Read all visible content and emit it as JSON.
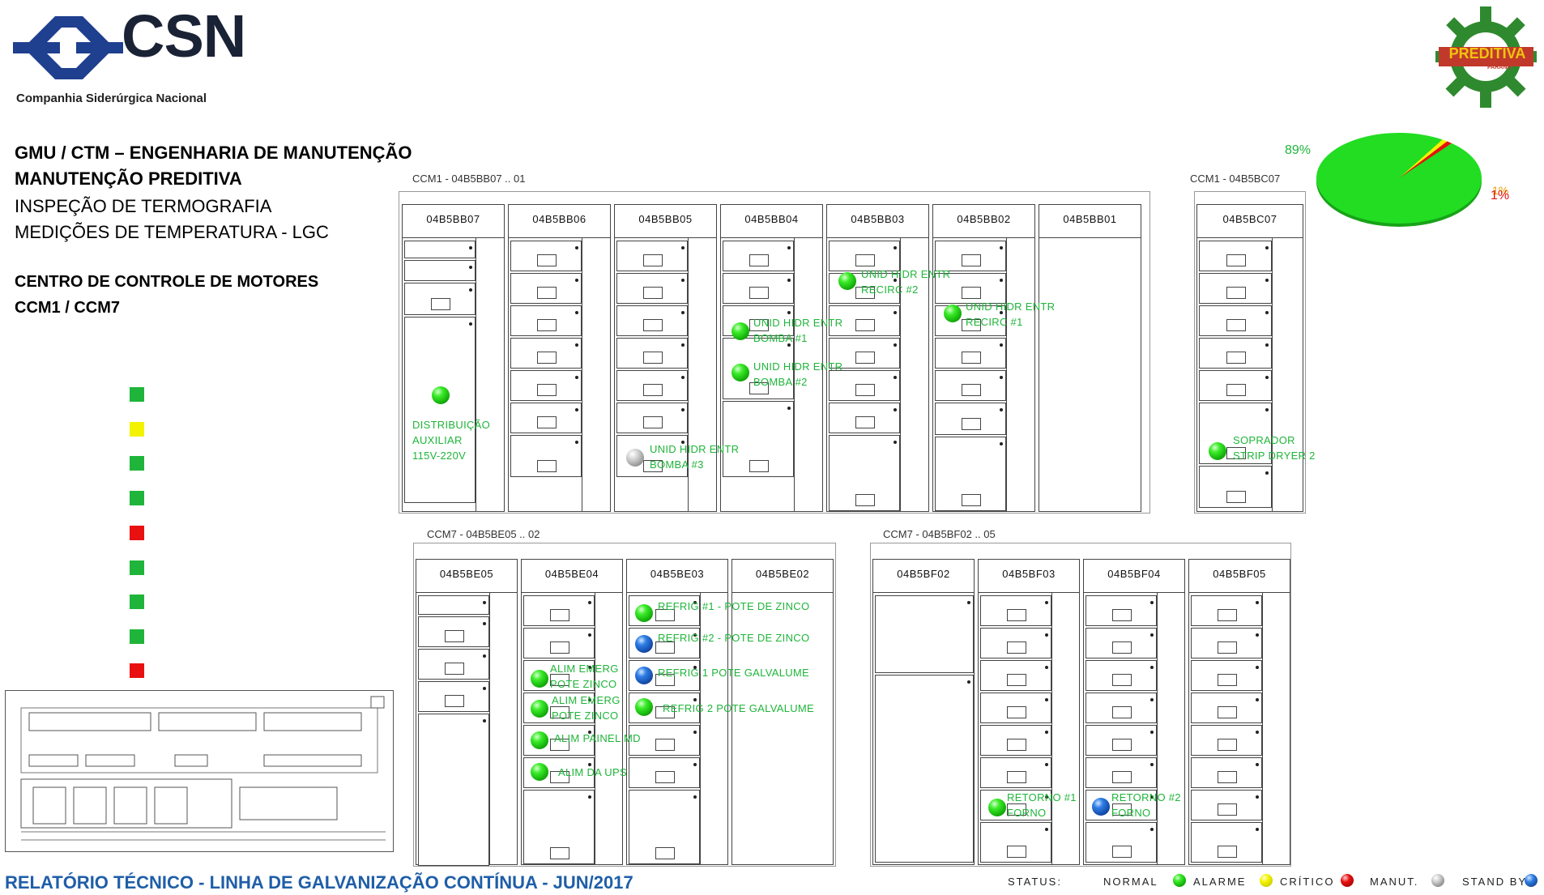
{
  "header": {
    "logo_text": "CSN",
    "company": "Companhia Siderúrgica Nacional",
    "line1": "GMU / CTM – ENGENHARIA DE MANUTENÇÃO",
    "line2": "MANUTENÇÃO PREDITIVA",
    "line3": "INSPEÇÃO DE TERMOGRAFIA",
    "line4": "MEDIÇÕES DE TEMPERATURA - LGC",
    "line5": "CENTRO DE CONTROLE DE MOTORES",
    "line6": "CCM1 / CCM7",
    "brand_logo_text": "PREDITIVA",
    "brand_logo_sub": "PARANÁ"
  },
  "footer": {
    "title": "RELATÓRIO TÉCNICO - LINHA DE GALVANIZAÇÃO CONTÍNUA - JUN/2017"
  },
  "status_squares": [
    {
      "color": "#1fb53a"
    },
    {
      "color": "#f3f300"
    },
    {
      "color": "#1fb53a"
    },
    {
      "color": "#1fb53a"
    },
    {
      "color": "#e81010"
    },
    {
      "color": "#1fb53a"
    },
    {
      "color": "#1fb53a"
    },
    {
      "color": "#1fb53a"
    },
    {
      "color": "#e81010"
    }
  ],
  "pie": {
    "label_main": "89%",
    "label_small_1": "1%",
    "label_small_2": "1%",
    "colors": {
      "normal": "#22dd22",
      "alarme": "#f3f300",
      "critico": "#e81010"
    },
    "chart_data": {
      "type": "pie",
      "values": [
        89,
        1,
        1
      ],
      "labels": [
        "89%",
        "1%",
        "1%"
      ]
    }
  },
  "groups": {
    "ccm1_bb": {
      "title": "CCM1 - 04B5BB07 .. 01",
      "cabinets": [
        "04B5BB07",
        "04B5BB06",
        "04B5BB05",
        "04B5BB04",
        "04B5BB03",
        "04B5BB02",
        "04B5BB01"
      ]
    },
    "ccm1_bc": {
      "title": "CCM1 - 04B5BC07",
      "cabinets": [
        "04B5BC07"
      ]
    },
    "ccm7_be": {
      "title": "CCM7 - 04B5BE05 .. 02",
      "cabinets": [
        "04B5BE05",
        "04B5BE04",
        "04B5BE03",
        "04B5BE02"
      ]
    },
    "ccm7_bf": {
      "title": "CCM7 - 04B5BF02 .. 05",
      "cabinets": [
        "04B5BF02",
        "04B5BF03",
        "04B5BF04",
        "04B5BF05"
      ]
    }
  },
  "points": {
    "dist_aux": {
      "l1": "DISTRIBUIÇÃO",
      "l2": "AUXILIAR",
      "l3": "115V-220V",
      "status": "normal"
    },
    "bomba3": {
      "l1": "UNID HIDR ENTR",
      "l2": "BOMBA #3",
      "status": "manut"
    },
    "bomba1": {
      "l1": "UNID HIDR ENTR",
      "l2": "BOMBA #1",
      "status": "normal"
    },
    "bomba2": {
      "l1": "UNID HIDR ENTR",
      "l2": "BOMBA #2",
      "status": "normal"
    },
    "recirc2": {
      "l1": "UNID HIDR ENTR",
      "l2": "RECIRC #2",
      "status": "normal"
    },
    "recirc1": {
      "l1": "UNID HIDR ENTR",
      "l2": "RECIRC #1",
      "status": "normal"
    },
    "soprador": {
      "l1": "SOPRADOR",
      "l2": "STRIP DRYER 2",
      "status": "normal"
    },
    "refrig1_zinco": {
      "l1": "REFRIG #1 - POTE DE ZINCO",
      "status": "normal"
    },
    "refrig2_zinco": {
      "l1": "REFRIG #2 - POTE DE ZINCO",
      "status": "standby"
    },
    "refrig1_galv": {
      "l1": "REFRIG 1 POTE GALVALUME",
      "status": "standby"
    },
    "refrig2_galv": {
      "l1": "REFRIG 2 POTE GALVALUME",
      "status": "normal"
    },
    "alim_emerg1": {
      "l1": "ALIM EMERG",
      "l2": "POTE ZINCO",
      "status": "normal"
    },
    "alim_emerg2": {
      "l1": "ALIM EMERG",
      "l2": "POTE ZINCO",
      "status": "normal"
    },
    "alim_painel": {
      "l1": "ALIM PAINEL MD",
      "status": "normal"
    },
    "alim_ups": {
      "l1": "ALIM DA UPS",
      "status": "normal"
    },
    "retorno1": {
      "l1": "RETORNO #1",
      "l2": "FORNO",
      "status": "normal"
    },
    "retorno2": {
      "l1": "RETORNO #2",
      "l2": "FORNO",
      "status": "standby"
    }
  },
  "legend": {
    "status_label": "STATUS:",
    "normal": "NORMAL",
    "alarme": "ALARME",
    "critico": "CRÍTICO",
    "manut": "MANUT.",
    "standby": "STAND BY"
  }
}
